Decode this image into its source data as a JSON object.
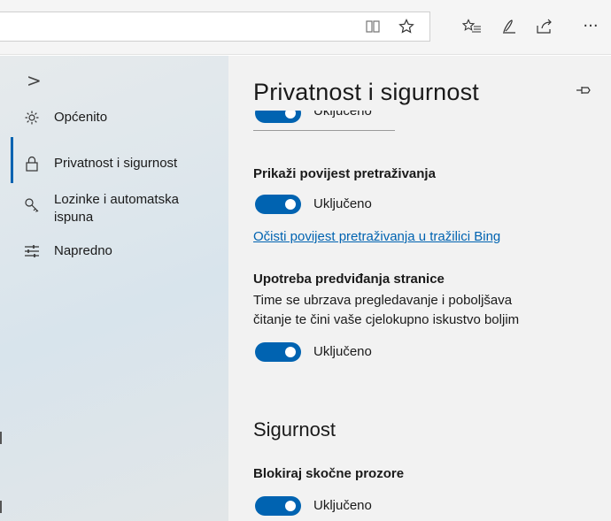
{
  "toolbar": {
    "icons": [
      "reading-view-icon",
      "favorite-star-icon",
      "favorites-list-icon",
      "pen-icon",
      "share-icon",
      "more-icon"
    ],
    "more_label": "···"
  },
  "sidebar": {
    "chevron": ">",
    "items": [
      {
        "label": "Općenito",
        "icon": "gear-icon"
      },
      {
        "label": "Privatnost i sigurnost",
        "icon": "lock-icon",
        "active": true
      },
      {
        "label": "Lozinke i automatska ispuna",
        "icon": "key-icon"
      },
      {
        "label": "Napredno",
        "icon": "sliders-icon"
      }
    ],
    "item3_line1": "Lozinke i automatska",
    "item3_line2": "ispuna"
  },
  "panel": {
    "title": "Privatnost i sigurnost",
    "clipped_toggle_label": "Uključeno",
    "history": {
      "title": "Prikaži povijest pretraživanja",
      "toggle_label": "Uključeno",
      "link": "Očisti povijest pretraživanja u tražilici Bing"
    },
    "prediction": {
      "title": "Upotreba predviđanja stranice",
      "desc_line1": "Time se ubrzava pregledavanje i poboljšava",
      "desc_line2": "čitanje te čini vaše cjelokupno iskustvo boljim",
      "toggle_label": "Uključeno"
    },
    "security_section": "Sigurnost",
    "popups": {
      "title": "Blokiraj skočne prozore",
      "toggle_label": "Uključeno"
    }
  },
  "colors": {
    "accent": "#0063b1",
    "panel_bg": "#f2f2f2",
    "sidebar_bg": "#e0e7ec"
  }
}
